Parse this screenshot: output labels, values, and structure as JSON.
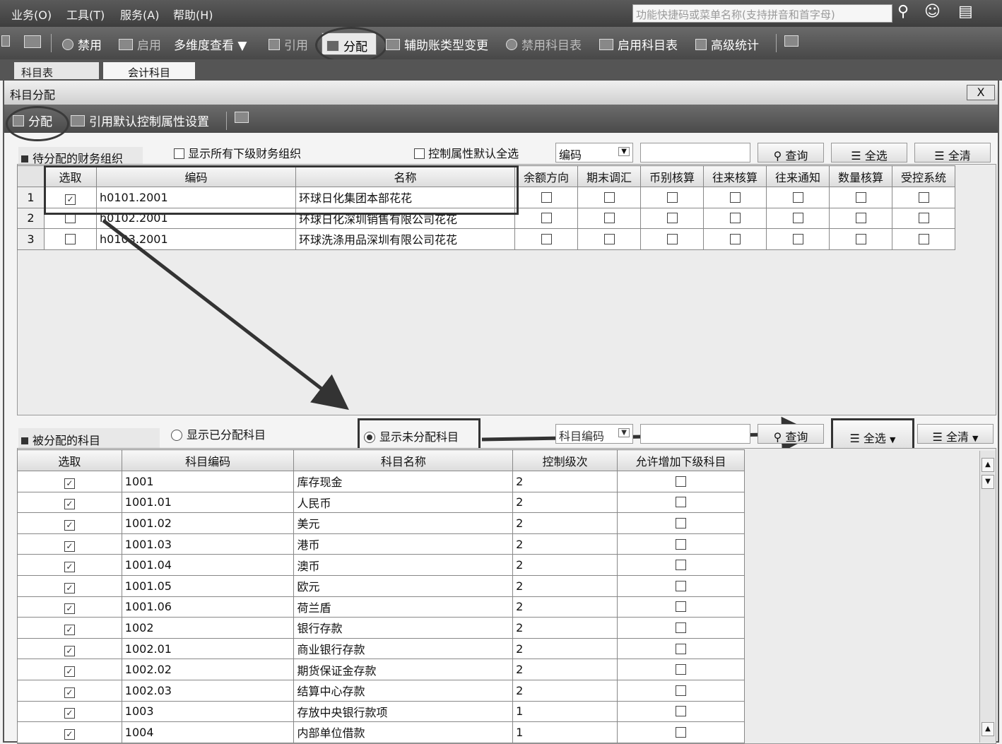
{
  "menubar": {
    "items": [
      "业务(O)",
      "工具(T)",
      "服务(A)",
      "帮助(H)"
    ],
    "search_placeholder": "功能快捷码或菜单名称(支持拼音和首字母)"
  },
  "toolbar": {
    "disable": "禁用",
    "enable": "启用",
    "multi_view": "多维度查看",
    "quote": "引用",
    "assign": "分配",
    "aux_change": "辅助账类型变更",
    "disable_table": "禁用科目表",
    "enable_table": "启用科目表",
    "advanced_stats": "高级统计"
  },
  "tabs": [
    "科目表",
    "会计科目"
  ],
  "dialog": {
    "title": "科目分配",
    "close": "X",
    "toolbar": {
      "assign": "分配",
      "quote_default": "引用默认控制属性设置"
    }
  },
  "upper": {
    "section_label": "待分配的财务组织",
    "show_all_sub": "显示所有下级财务组织",
    "ctrl_default_all": "控制属性默认全选",
    "search_field": "编码",
    "query": "查询",
    "select_all": "全选",
    "clear_all": "全清",
    "columns": [
      "选取",
      "编码",
      "名称",
      "余额方向",
      "期末调汇",
      "币别核算",
      "往来核算",
      "往来通知",
      "数量核算",
      "受控系统"
    ],
    "rows": [
      {
        "num": "1",
        "checked": true,
        "code": "h0101.2001",
        "name": "环球日化集团本部花花"
      },
      {
        "num": "2",
        "checked": false,
        "code": "h0102.2001",
        "name": "环球日化深圳销售有限公司花花"
      },
      {
        "num": "3",
        "checked": false,
        "code": "h0103.2001",
        "name": "环球洗涤用品深圳有限公司花花"
      }
    ]
  },
  "lower": {
    "section_label": "被分配的科目",
    "show_assigned": "显示已分配科目",
    "show_unassigned": "显示未分配科目",
    "search_field": "科目编码",
    "query": "查询",
    "select_all": "全选",
    "clear_all": "全清",
    "columns": [
      "选取",
      "科目编码",
      "科目名称",
      "控制级次",
      "允许增加下级科目"
    ],
    "rows": [
      {
        "code": "1001",
        "name": "库存现金",
        "level": "2"
      },
      {
        "code": "1001.01",
        "name": "人民币",
        "level": "2"
      },
      {
        "code": "1001.02",
        "name": "美元",
        "level": "2"
      },
      {
        "code": "1001.03",
        "name": "港币",
        "level": "2"
      },
      {
        "code": "1001.04",
        "name": "澳币",
        "level": "2"
      },
      {
        "code": "1001.05",
        "name": "欧元",
        "level": "2"
      },
      {
        "code": "1001.06",
        "name": "荷兰盾",
        "level": "2"
      },
      {
        "code": "1002",
        "name": "银行存款",
        "level": "2"
      },
      {
        "code": "1002.01",
        "name": "商业银行存款",
        "level": "2"
      },
      {
        "code": "1002.02",
        "name": "期货保证金存款",
        "level": "2"
      },
      {
        "code": "1002.03",
        "name": "结算中心存款",
        "level": "2"
      },
      {
        "code": "1003",
        "name": "存放中央银行款项",
        "level": "1"
      },
      {
        "code": "1004",
        "name": "内部单位借款",
        "level": "1"
      }
    ]
  }
}
